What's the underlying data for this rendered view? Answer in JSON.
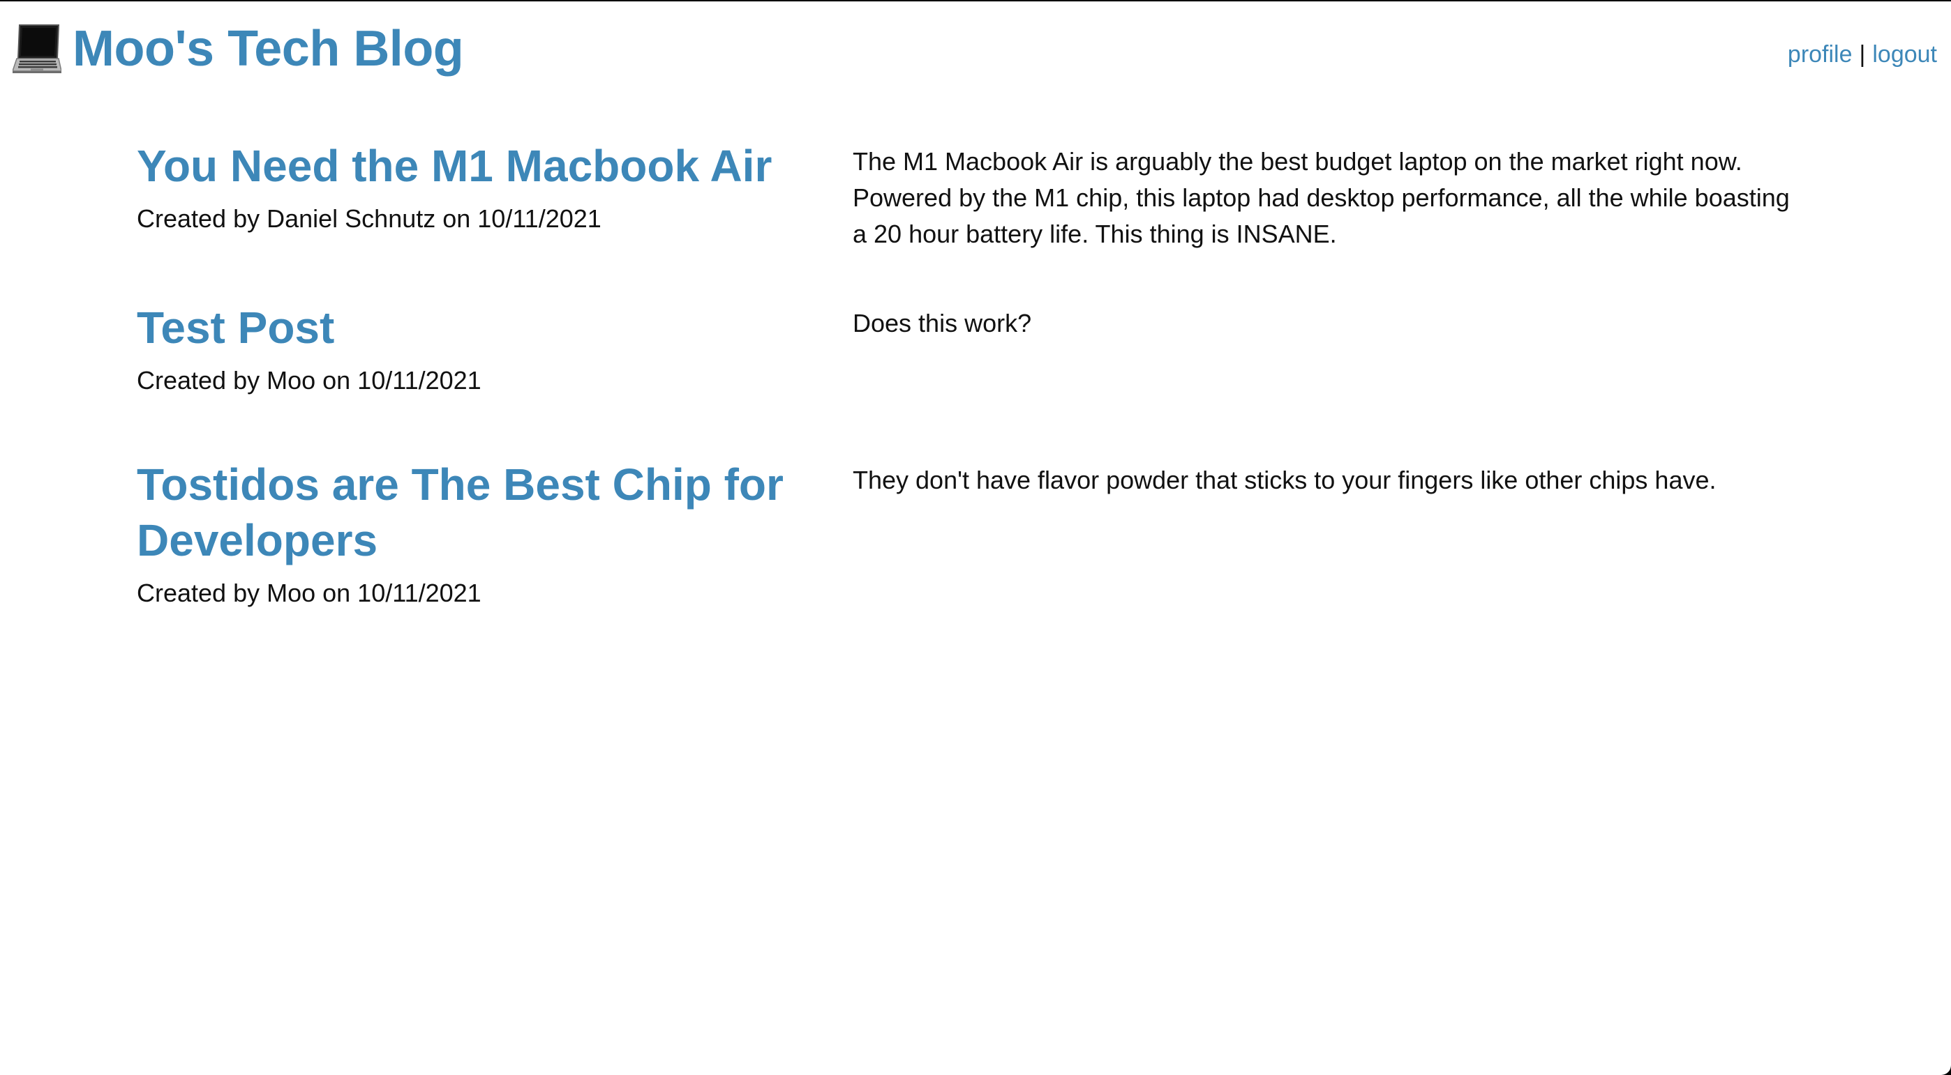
{
  "header": {
    "brand_icon": "laptop-icon",
    "title": "Moo's Tech Blog",
    "nav": {
      "profile_label": "profile",
      "separator": "|",
      "logout_label": "logout"
    }
  },
  "colors": {
    "accent": "#3d87b8",
    "text": "#111111",
    "background": "#ffffff"
  },
  "posts": [
    {
      "title": "You Need the M1 Macbook Air",
      "meta": "Created by Daniel Schnutz on 10/11/2021",
      "body": "The M1 Macbook Air is arguably the best budget laptop on the market right now. Powered by the M1 chip, this laptop had desktop performance, all the while boasting a 20 hour battery life. This thing is INSANE."
    },
    {
      "title": "Test Post",
      "meta": "Created by Moo on 10/11/2021",
      "body": "Does this work?"
    },
    {
      "title": "Tostidos are The Best Chip for Developers",
      "meta": "Created by Moo on 10/11/2021",
      "body": "They don't have flavor powder that sticks to your fingers like other chips have."
    }
  ]
}
